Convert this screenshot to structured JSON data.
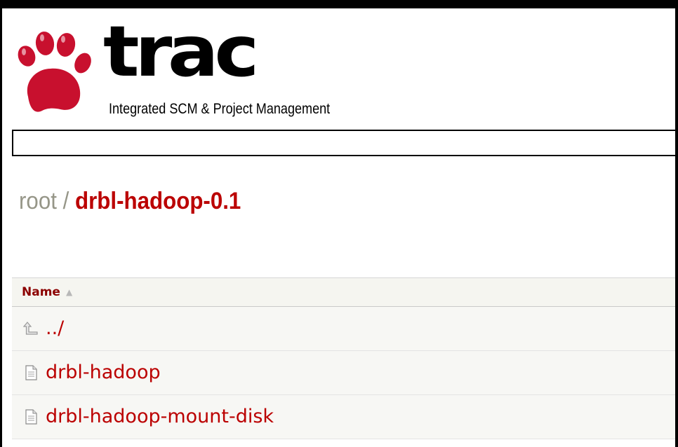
{
  "logo": {
    "wordmark": "trac",
    "tagline": "Integrated SCM & Project Management"
  },
  "path": {
    "root": "root",
    "separator": "/",
    "current": "drbl-hadoop-0.1"
  },
  "listing": {
    "columns": [
      {
        "label": "Name",
        "sort_icon": "sort-ascending-icon"
      }
    ],
    "rows": [
      {
        "name": "../",
        "icon": "parent-dir-icon"
      },
      {
        "name": "drbl-hadoop",
        "icon": "file-icon"
      },
      {
        "name": "drbl-hadoop-mount-disk",
        "icon": "file-icon"
      }
    ]
  },
  "colors": {
    "link": "#bb0000",
    "header_text": "#8b0000",
    "root_text": "#969688",
    "logo_red": "#c8102e"
  }
}
